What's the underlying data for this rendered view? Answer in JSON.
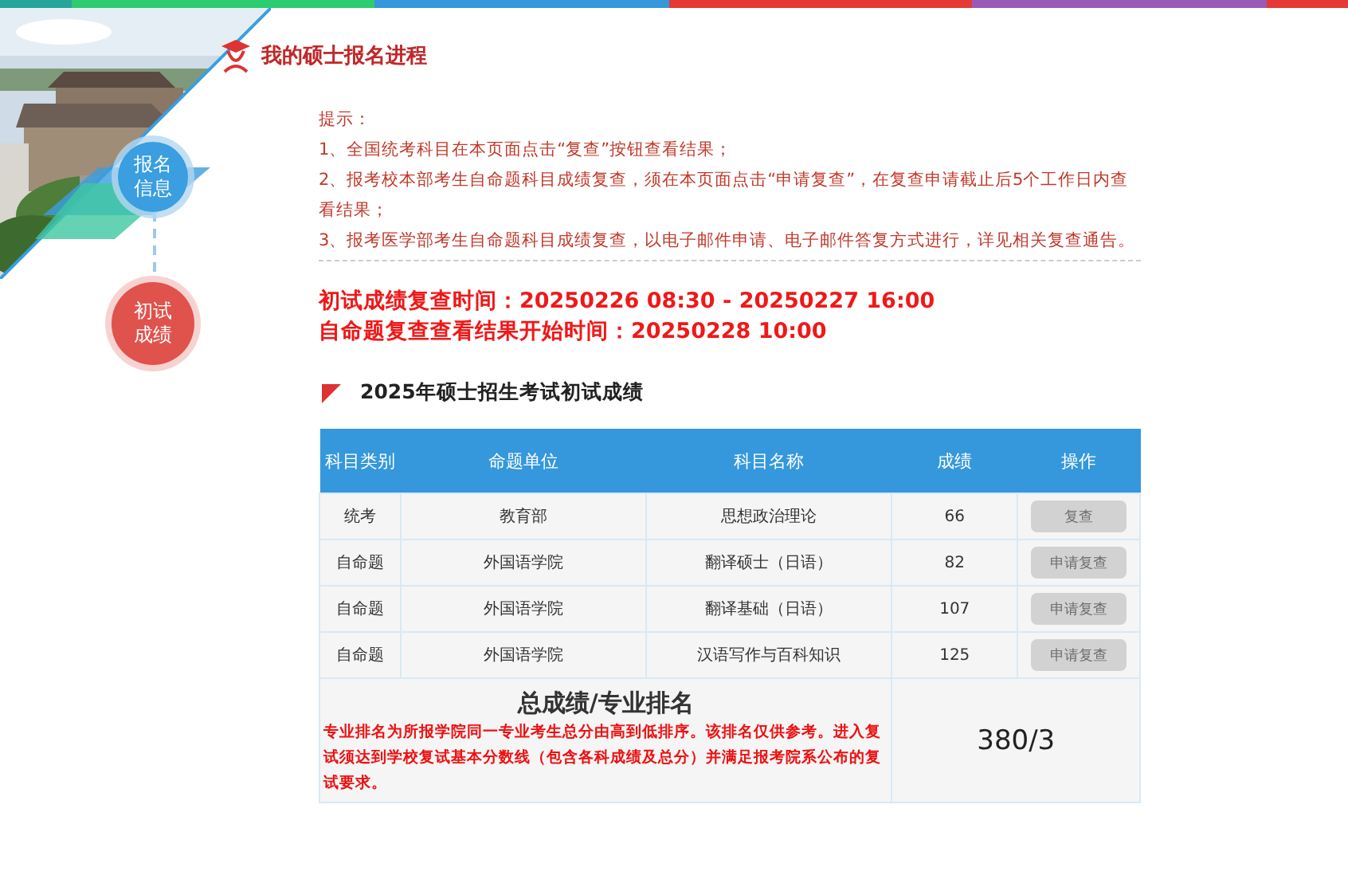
{
  "header": {
    "title": "我的硕士报名进程"
  },
  "steps": [
    {
      "label": "报名信息",
      "selected": false
    },
    {
      "label": "初试成绩",
      "selected": true
    }
  ],
  "notice": {
    "heading": "提示：",
    "lines": [
      "1、全国统考科目在本页面点击“复查”按钮查看结果；",
      "2、报考校本部考生自命题科目成绩复查，须在本页面点击“申请复查”，在复查申请截止后5个工作日内查看结果；",
      "3、报考医学部考生自命题科目成绩复查，以电子邮件申请、电子邮件答复方式进行，详见相关复查通告。"
    ]
  },
  "deadlines": [
    "初试成绩复查时间：20250226 08:30 - 20250227 16:00",
    "自命题复查查看结果开始时间：20250228 10:00"
  ],
  "section_title": "2025年硕士招生考试初试成绩",
  "table": {
    "columns": [
      "科目类别",
      "命题单位",
      "科目名称",
      "成绩",
      "操作"
    ],
    "rows": [
      {
        "category": "统考",
        "unit": "教育部",
        "subject": "思想政治理论",
        "score": "66",
        "action": "复查",
        "disabled": true
      },
      {
        "category": "自命题",
        "unit": "外国语学院",
        "subject": "翻译硕士（日语）",
        "score": "82",
        "action": "申请复查",
        "disabled": true
      },
      {
        "category": "自命题",
        "unit": "外国语学院",
        "subject": "翻译基础（日语）",
        "score": "107",
        "action": "申请复查",
        "disabled": true
      },
      {
        "category": "自命题",
        "unit": "外国语学院",
        "subject": "汉语写作与百科知识",
        "score": "125",
        "action": "申请复查",
        "disabled": true
      }
    ],
    "summary": {
      "label": "总成绩/专业排名",
      "note": "专业排名为所报学院同一专业考生总分由高到低排序。该排名仅供参考。进入复试须达到学校复试基本分数线（包含各科成绩及总分）并满足报考院系公布的复试要求。",
      "value": "380/3"
    }
  }
}
